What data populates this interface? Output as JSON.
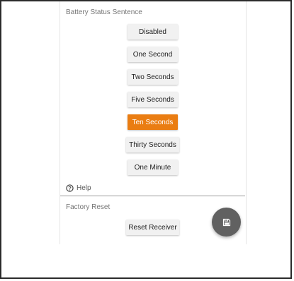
{
  "battery_status": {
    "title": "Battery Status Sentence",
    "options": [
      {
        "label": "Disabled",
        "selected": false
      },
      {
        "label": "One Second",
        "selected": false
      },
      {
        "label": "Two Seconds",
        "selected": false
      },
      {
        "label": "Five Seconds",
        "selected": false
      },
      {
        "label": "Ten Seconds",
        "selected": true
      },
      {
        "label": "Thirty Seconds",
        "selected": false
      },
      {
        "label": "One Minute",
        "selected": false
      }
    ]
  },
  "help": {
    "label": "Help",
    "icon": "help-circle-icon"
  },
  "factory_reset": {
    "title": "Factory Reset",
    "button_label": "Reset Receiver"
  },
  "fab": {
    "icon": "save-icon"
  },
  "colors": {
    "accent": "#ea7d12",
    "button_bg": "#f1f1f1",
    "fab_bg": "#616161"
  }
}
